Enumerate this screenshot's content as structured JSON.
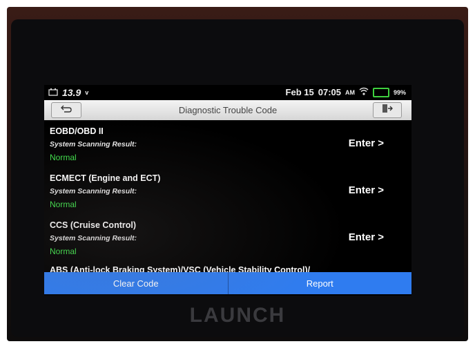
{
  "device": {
    "brand": "LAUNCH"
  },
  "status_bar": {
    "voltage": "13.9",
    "voltage_unit": "v",
    "date": "Feb 15",
    "time": "07:05",
    "ampm": "AM",
    "battery_percent": "99%",
    "icons": [
      "car-battery-icon",
      "wifi-icon",
      "battery-icon"
    ]
  },
  "header": {
    "title": "Diagnostic Trouble Code",
    "back_icon": "back-icon",
    "exit_icon": "exit-icon"
  },
  "systems": [
    {
      "name": "EOBD/OBD II",
      "result_label": "System Scanning Result:",
      "status": "Normal",
      "action": "Enter >"
    },
    {
      "name": "ECMECT (Engine and ECT)",
      "result_label": "System Scanning Result:",
      "status": "Normal",
      "action": "Enter >"
    },
    {
      "name": "CCS (Cruise Control)",
      "result_label": "System Scanning Result:",
      "status": "Normal",
      "action": "Enter >"
    },
    {
      "name": "ABS (Anti-lock Braking System)/VSC (Vehicle Stability Control)/"
    }
  ],
  "footer": {
    "clear_code": "Clear Code",
    "report": "Report"
  },
  "colors": {
    "status_normal": "#3fe04a",
    "footer_bg": "#2f7cf0"
  }
}
